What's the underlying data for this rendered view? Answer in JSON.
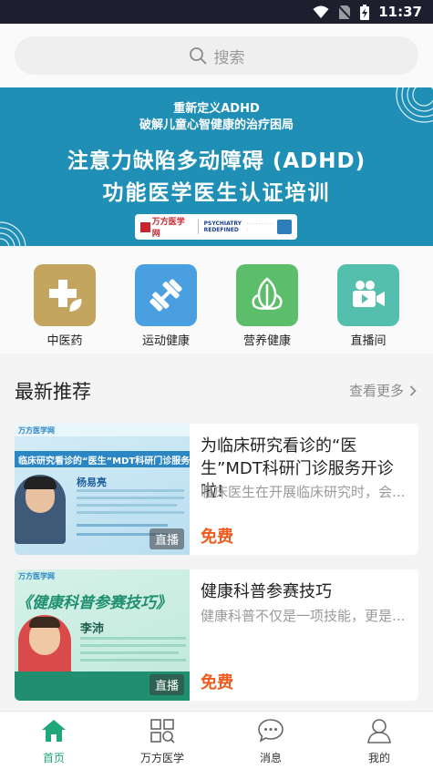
{
  "status_bar": {
    "time": "11:37"
  },
  "search": {
    "placeholder": "搜索"
  },
  "banner": {
    "line1": "重新定义ADHD",
    "line2": "破解儿童心智健康的治疗困局",
    "headline1": "注意力缺陷多动障碍 (ADHD)",
    "headline2": "功能医学医生认证培训",
    "logo1": "万方医学网",
    "logo2a": "PSYCHIATRY",
    "logo2b": "REDEFINED"
  },
  "categories": [
    {
      "label": "中医药",
      "icon": "herb-cross-icon",
      "color": "#c4a55f"
    },
    {
      "label": "运动健康",
      "icon": "dumbbell-icon",
      "color": "#4a9fe0"
    },
    {
      "label": "营养健康",
      "icon": "leaf-icon",
      "color": "#5cbd6a"
    },
    {
      "label": "直播间",
      "icon": "video-camera-icon",
      "color": "#55bfae"
    }
  ],
  "recommend": {
    "title": "最新推荐",
    "more": "查看更多",
    "items": [
      {
        "title": "为临床研究看诊的“医生”MDT科研门诊服务开诊啦!",
        "desc": "临床医生在开展临床研究时，会...",
        "price": "免费",
        "tag": "直播",
        "thumb_name": "杨易亮",
        "thumb_header": "临床研究看诊的“医生”MDT科研门诊服务开诊"
      },
      {
        "title": "健康科普参赛技巧",
        "desc": "健康科普不仅是一项技能，更是...",
        "price": "免费",
        "tag": "直播",
        "thumb_name": "李沛",
        "thumb_header": "《健康科普参赛技巧》"
      }
    ]
  },
  "tabbar": [
    {
      "label": "首页",
      "icon": "home-icon",
      "active": true
    },
    {
      "label": "万方医学",
      "icon": "grid-search-icon",
      "active": false
    },
    {
      "label": "消息",
      "icon": "message-icon",
      "active": false
    },
    {
      "label": "我的",
      "icon": "user-icon",
      "active": false
    }
  ],
  "colors": {
    "accent": "#1fa67a",
    "price": "#ef5a1e",
    "banner": "#1f8fb6"
  }
}
